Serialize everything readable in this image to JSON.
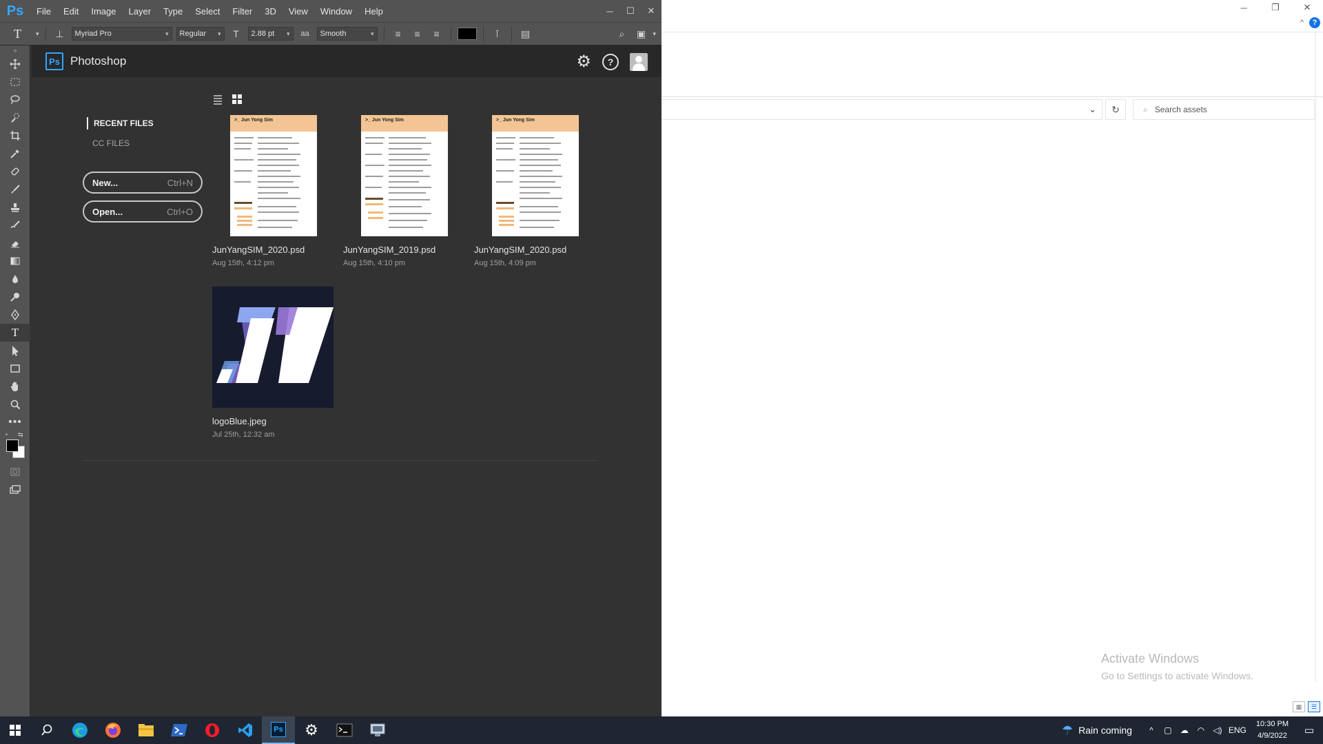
{
  "photoshop": {
    "app_logo": "Ps",
    "menu": [
      "File",
      "Edit",
      "Image",
      "Layer",
      "Type",
      "Select",
      "Filter",
      "3D",
      "View",
      "Window",
      "Help"
    ],
    "window_controls": [
      "minimize-icon",
      "maximize-icon",
      "close-icon"
    ],
    "options_bar": {
      "font_family": "Myriad Pro",
      "font_style": "Regular",
      "font_size": "2.88 pt",
      "antialias": "Smooth",
      "text_color": "#000000"
    },
    "tools": [
      "move",
      "marquee",
      "lasso",
      "quick-selection",
      "crop",
      "eyedropper",
      "healing",
      "brush",
      "stamp",
      "history-brush",
      "eraser",
      "gradient",
      "blur",
      "dodge",
      "pen",
      "type",
      "path-selection",
      "rectangle",
      "hand",
      "zoom",
      "more"
    ],
    "selected_tool": "type"
  },
  "home": {
    "logo": "Ps",
    "title": "Photoshop",
    "nav": {
      "recent": "RECENT FILES",
      "cc": "CC FILES"
    },
    "actions": {
      "new_label": "New...",
      "new_shortcut": "Ctrl+N",
      "open_label": "Open...",
      "open_shortcut": "Ctrl+O"
    },
    "files": [
      {
        "name": "JunYangSIM_2020.psd",
        "date": "Aug 15th, 4:12 pm",
        "thumb_title": ">_ Jun Yong Sim"
      },
      {
        "name": "JunYangSIM_2019.psd",
        "date": "Aug 15th, 4:10 pm",
        "thumb_title": ">_ Jun Yong Sim"
      },
      {
        "name": "JunYangSIM_2020.psd",
        "date": "Aug 15th, 4:09 pm",
        "thumb_title": ">_ Jun Yong Sim"
      },
      {
        "name": "logoBlue.jpeg",
        "date": "Jul 25th, 12:32 am"
      }
    ]
  },
  "background_window": {
    "search_placeholder": "Search assets",
    "watermark_title": "Activate Windows",
    "watermark_sub": "Go to Settings to activate Windows."
  },
  "taskbar": {
    "apps": [
      "search",
      "edge",
      "firefox",
      "file-explorer",
      "powershell",
      "opera",
      "vscode",
      "photoshop",
      "settings",
      "terminal",
      "remote-app"
    ],
    "active_app": "photoshop",
    "weather": "Rain coming",
    "language": "ENG",
    "time": "10:30 PM",
    "date": "4/9/2022"
  },
  "colors": {
    "accent": "#31a8ff",
    "chrome": "#535353",
    "panel": "#323232",
    "taskbar": "#1f2631"
  }
}
